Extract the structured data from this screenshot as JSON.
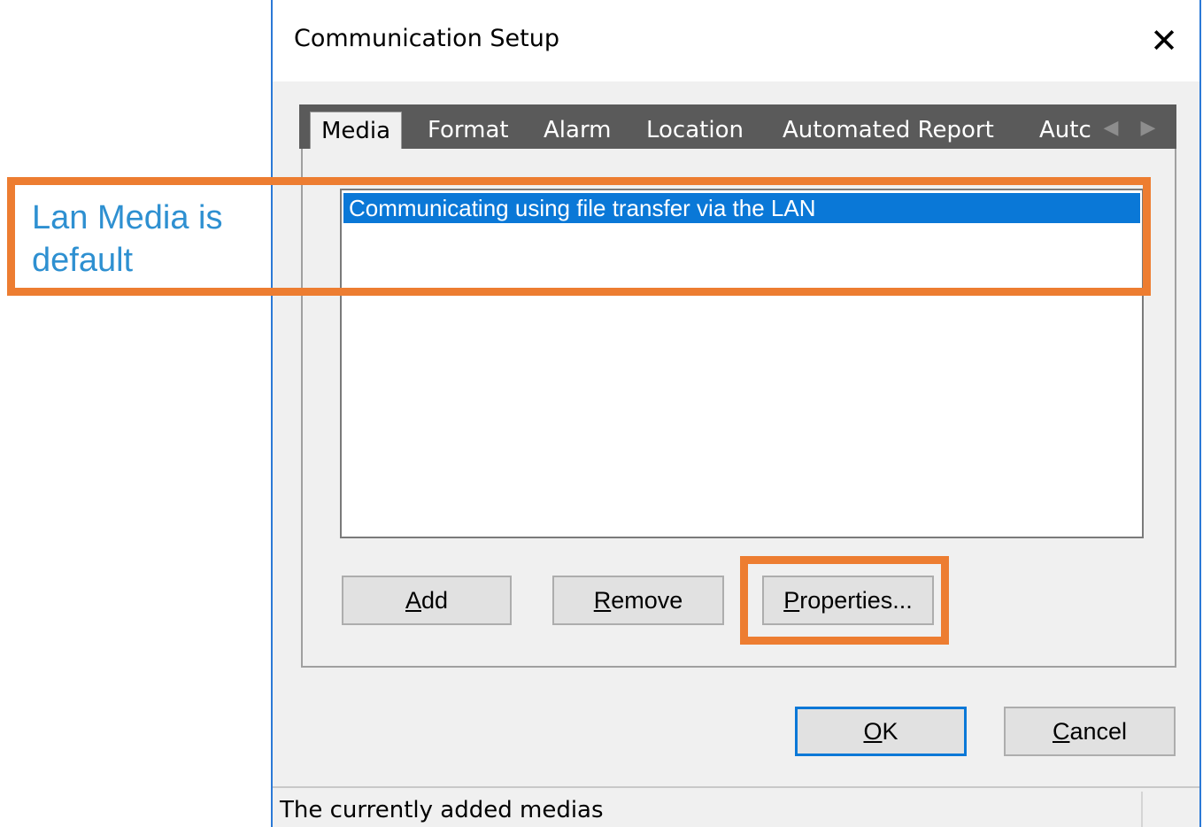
{
  "dialog": {
    "title": "Communication Setup",
    "close_glyph": "✕"
  },
  "tabs": [
    {
      "label": "Media",
      "active": true
    },
    {
      "label": "Format",
      "active": false
    },
    {
      "label": "Alarm",
      "active": false
    },
    {
      "label": "Location",
      "active": false
    },
    {
      "label": "Automated Report",
      "active": false
    },
    {
      "label": "Autc",
      "active": false
    }
  ],
  "tab_scroll": {
    "left_icon": "chevron-left-icon",
    "right_icon": "chevron-right-icon",
    "left_glyph": "◀",
    "right_glyph": "▶"
  },
  "media_list": {
    "items": [
      "Communicating using file transfer via the LAN"
    ],
    "selected_index": 0
  },
  "buttons": {
    "add": {
      "before": "",
      "mnemonic": "A",
      "after": "dd"
    },
    "remove": {
      "before": "",
      "mnemonic": "R",
      "after": "emove"
    },
    "properties": {
      "before": "",
      "mnemonic": "P",
      "after": "roperties..."
    },
    "ok": {
      "before": "",
      "mnemonic": "O",
      "after": "K"
    },
    "cancel": {
      "before": "",
      "mnemonic": "C",
      "after": "ancel"
    }
  },
  "status_bar": {
    "text": "The currently added medias"
  },
  "annotation": {
    "callout_line1": "Lan Media is",
    "callout_line2": "default",
    "highlight_color": "#ed7d31",
    "callout_text_color": "#2e90d1"
  },
  "colors": {
    "selection": "#0a78d7",
    "window_border": "#2b79d6",
    "tabstrip_bg": "#5a5a5a"
  }
}
